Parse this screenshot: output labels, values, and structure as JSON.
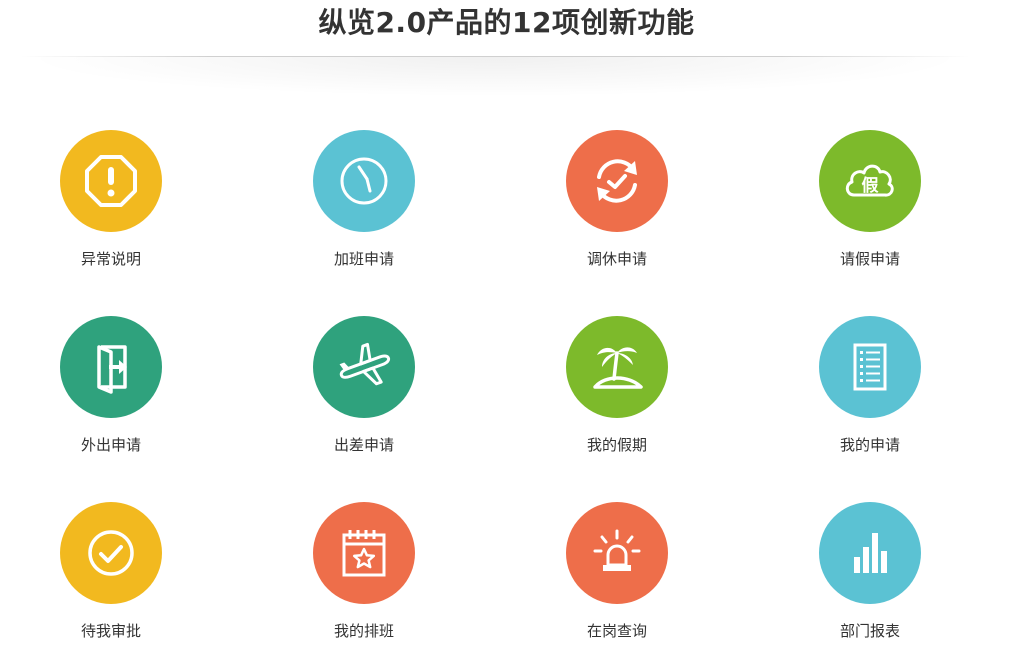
{
  "page": {
    "title": "纵览2.0产品的12项创新功能"
  },
  "features": [
    {
      "label": "异常说明",
      "icon": "warning-octagon-icon",
      "color": "#f2b91f"
    },
    {
      "label": "加班申请",
      "icon": "clock-icon",
      "color": "#5bc2d3"
    },
    {
      "label": "调休申请",
      "icon": "refresh-check-icon",
      "color": "#ee6e4a"
    },
    {
      "label": "请假申请",
      "icon": "leave-cloud-icon",
      "color": "#7dba2b"
    },
    {
      "label": "外出申请",
      "icon": "exit-door-icon",
      "color": "#2fa27d"
    },
    {
      "label": "出差申请",
      "icon": "airplane-icon",
      "color": "#2fa27d"
    },
    {
      "label": "我的假期",
      "icon": "palm-island-icon",
      "color": "#7dba2b"
    },
    {
      "label": "我的申请",
      "icon": "list-document-icon",
      "color": "#5bc2d3"
    },
    {
      "label": "待我审批",
      "icon": "check-circle-icon",
      "color": "#f2b91f"
    },
    {
      "label": "我的排班",
      "icon": "calendar-star-icon",
      "color": "#ee6e4a"
    },
    {
      "label": "在岗查询",
      "icon": "alarm-light-icon",
      "color": "#ee6e4a"
    },
    {
      "label": "部门报表",
      "icon": "bar-chart-icon",
      "color": "#5bc2d3"
    }
  ]
}
